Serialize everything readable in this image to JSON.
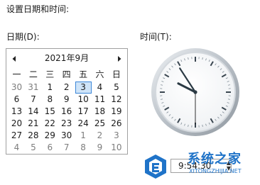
{
  "dialog": {
    "title": "设置日期和时间:",
    "date_label": "日期(D):",
    "time_label": "时间(T):"
  },
  "calendar": {
    "month_year": "2021年9月",
    "weekdays": [
      "一",
      "二",
      "三",
      "四",
      "五",
      "六",
      "日"
    ],
    "weeks": [
      [
        "30",
        "31",
        "1",
        "2",
        "3",
        "4",
        "5"
      ],
      [
        "6",
        "7",
        "8",
        "9",
        "10",
        "11",
        "12"
      ],
      [
        "13",
        "14",
        "15",
        "16",
        "17",
        "18",
        "19"
      ],
      [
        "20",
        "21",
        "22",
        "23",
        "24",
        "25",
        "26"
      ],
      [
        "27",
        "28",
        "29",
        "30",
        "1",
        "2",
        "3"
      ],
      [
        "4",
        "5",
        "6",
        "7",
        "8",
        "9",
        "10"
      ]
    ],
    "selected_day": "3",
    "prev_icon": "chevron-left-icon",
    "next_icon": "chevron-right-icon"
  },
  "clock": {
    "hour": 9,
    "minute": 54,
    "second": 30
  },
  "time_field": {
    "value": "9:54:30"
  },
  "watermark": {
    "title": "系统之家",
    "url": "XITONGZHIJIA.NET"
  },
  "colors": {
    "selected_border": "#3b86d8",
    "selected_fill": "#cfe4f8",
    "watermark_blue": "#1f73c8"
  }
}
